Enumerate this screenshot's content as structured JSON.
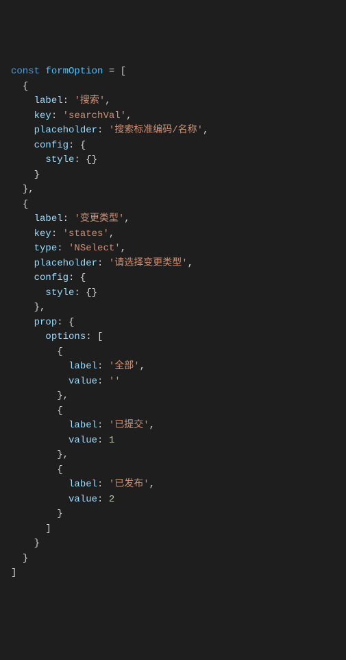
{
  "tokens": {
    "kw_const": "const",
    "var_name": "formOption",
    "eq": " = ",
    "lbracket": "[",
    "rbracket": "]",
    "lbrace": "{",
    "rbrace": "}",
    "rbrace_comma": "},",
    "colon": ":",
    "comma": ",",
    "empty_obj": "{}"
  },
  "item1": {
    "label_key": "label",
    "label_val": "'搜索'",
    "key_key": "key",
    "key_val": "'searchVal'",
    "placeholder_key": "placeholder",
    "placeholder_val": "'搜索标准编码/名称'",
    "config_key": "config",
    "style_key": "style"
  },
  "item2": {
    "label_key": "label",
    "label_val": "'变更类型'",
    "key_key": "key",
    "key_val": "'states'",
    "type_key": "type",
    "type_val": "'NSelect'",
    "placeholder_key": "placeholder",
    "placeholder_val": "'请选择变更类型'",
    "config_key": "config",
    "style_key": "style",
    "prop_key": "prop",
    "options_key": "options",
    "opt1_label_key": "label",
    "opt1_label_val": "'全部'",
    "opt1_value_key": "value",
    "opt1_value_val": "''",
    "opt2_label_key": "label",
    "opt2_label_val": "'已提交'",
    "opt2_value_key": "value",
    "opt2_value_val": "1",
    "opt3_label_key": "label",
    "opt3_label_val": "'已发布'",
    "opt3_value_key": "value",
    "opt3_value_val": "2"
  }
}
